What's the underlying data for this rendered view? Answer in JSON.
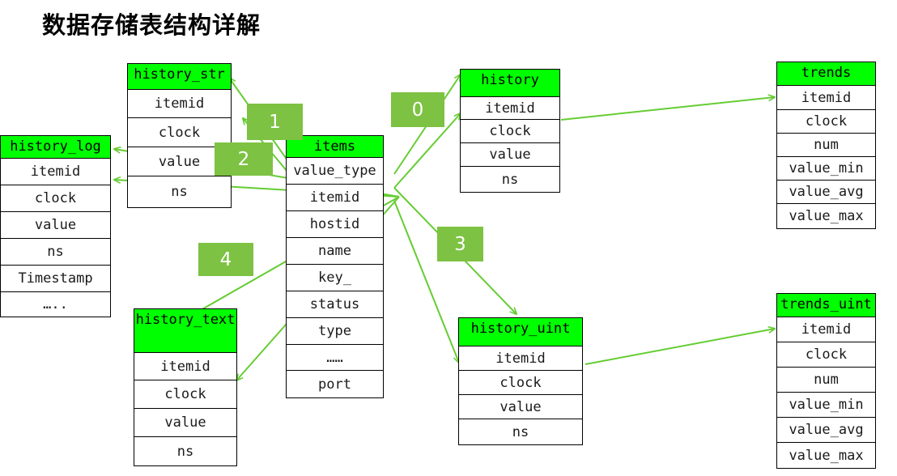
{
  "page": {
    "title": "数据存储表结构详解",
    "background": "#ffffff",
    "header_color": "#00ff00",
    "badge_color": "#7dc242",
    "arrow_color": "#66cc33",
    "border_color": "#000000"
  },
  "tables": {
    "history_log": {
      "name": "history_log",
      "fields": [
        "itemid",
        "clock",
        "value",
        "ns",
        "Timestamp",
        "….."
      ]
    },
    "history_str": {
      "name": "history_str",
      "fields": [
        "itemid",
        "clock",
        "value",
        "ns"
      ]
    },
    "items": {
      "name": "items",
      "fields": [
        "value_type",
        "itemid",
        "hostid",
        "name",
        "key_",
        "status",
        "type",
        "……",
        "port"
      ]
    },
    "history": {
      "name": "history",
      "fields": [
        "itemid",
        "clock",
        "value",
        "ns"
      ]
    },
    "trends": {
      "name": "trends",
      "fields": [
        "itemid",
        "clock",
        "num",
        "value_min",
        "value_avg",
        "value_max"
      ]
    },
    "history_text": {
      "name": "history_text",
      "fields": [
        "itemid",
        "clock",
        "value",
        "ns"
      ]
    },
    "history_uint": {
      "name": "history_uint",
      "fields": [
        "itemid",
        "clock",
        "value",
        "ns"
      ]
    },
    "trends_uint": {
      "name": "trends_uint",
      "fields": [
        "itemid",
        "clock",
        "num",
        "value_min",
        "value_avg",
        "value_max"
      ]
    }
  },
  "badges": [
    {
      "label": "0"
    },
    {
      "label": "1"
    },
    {
      "label": "2"
    },
    {
      "label": "3"
    },
    {
      "label": "4"
    }
  ]
}
